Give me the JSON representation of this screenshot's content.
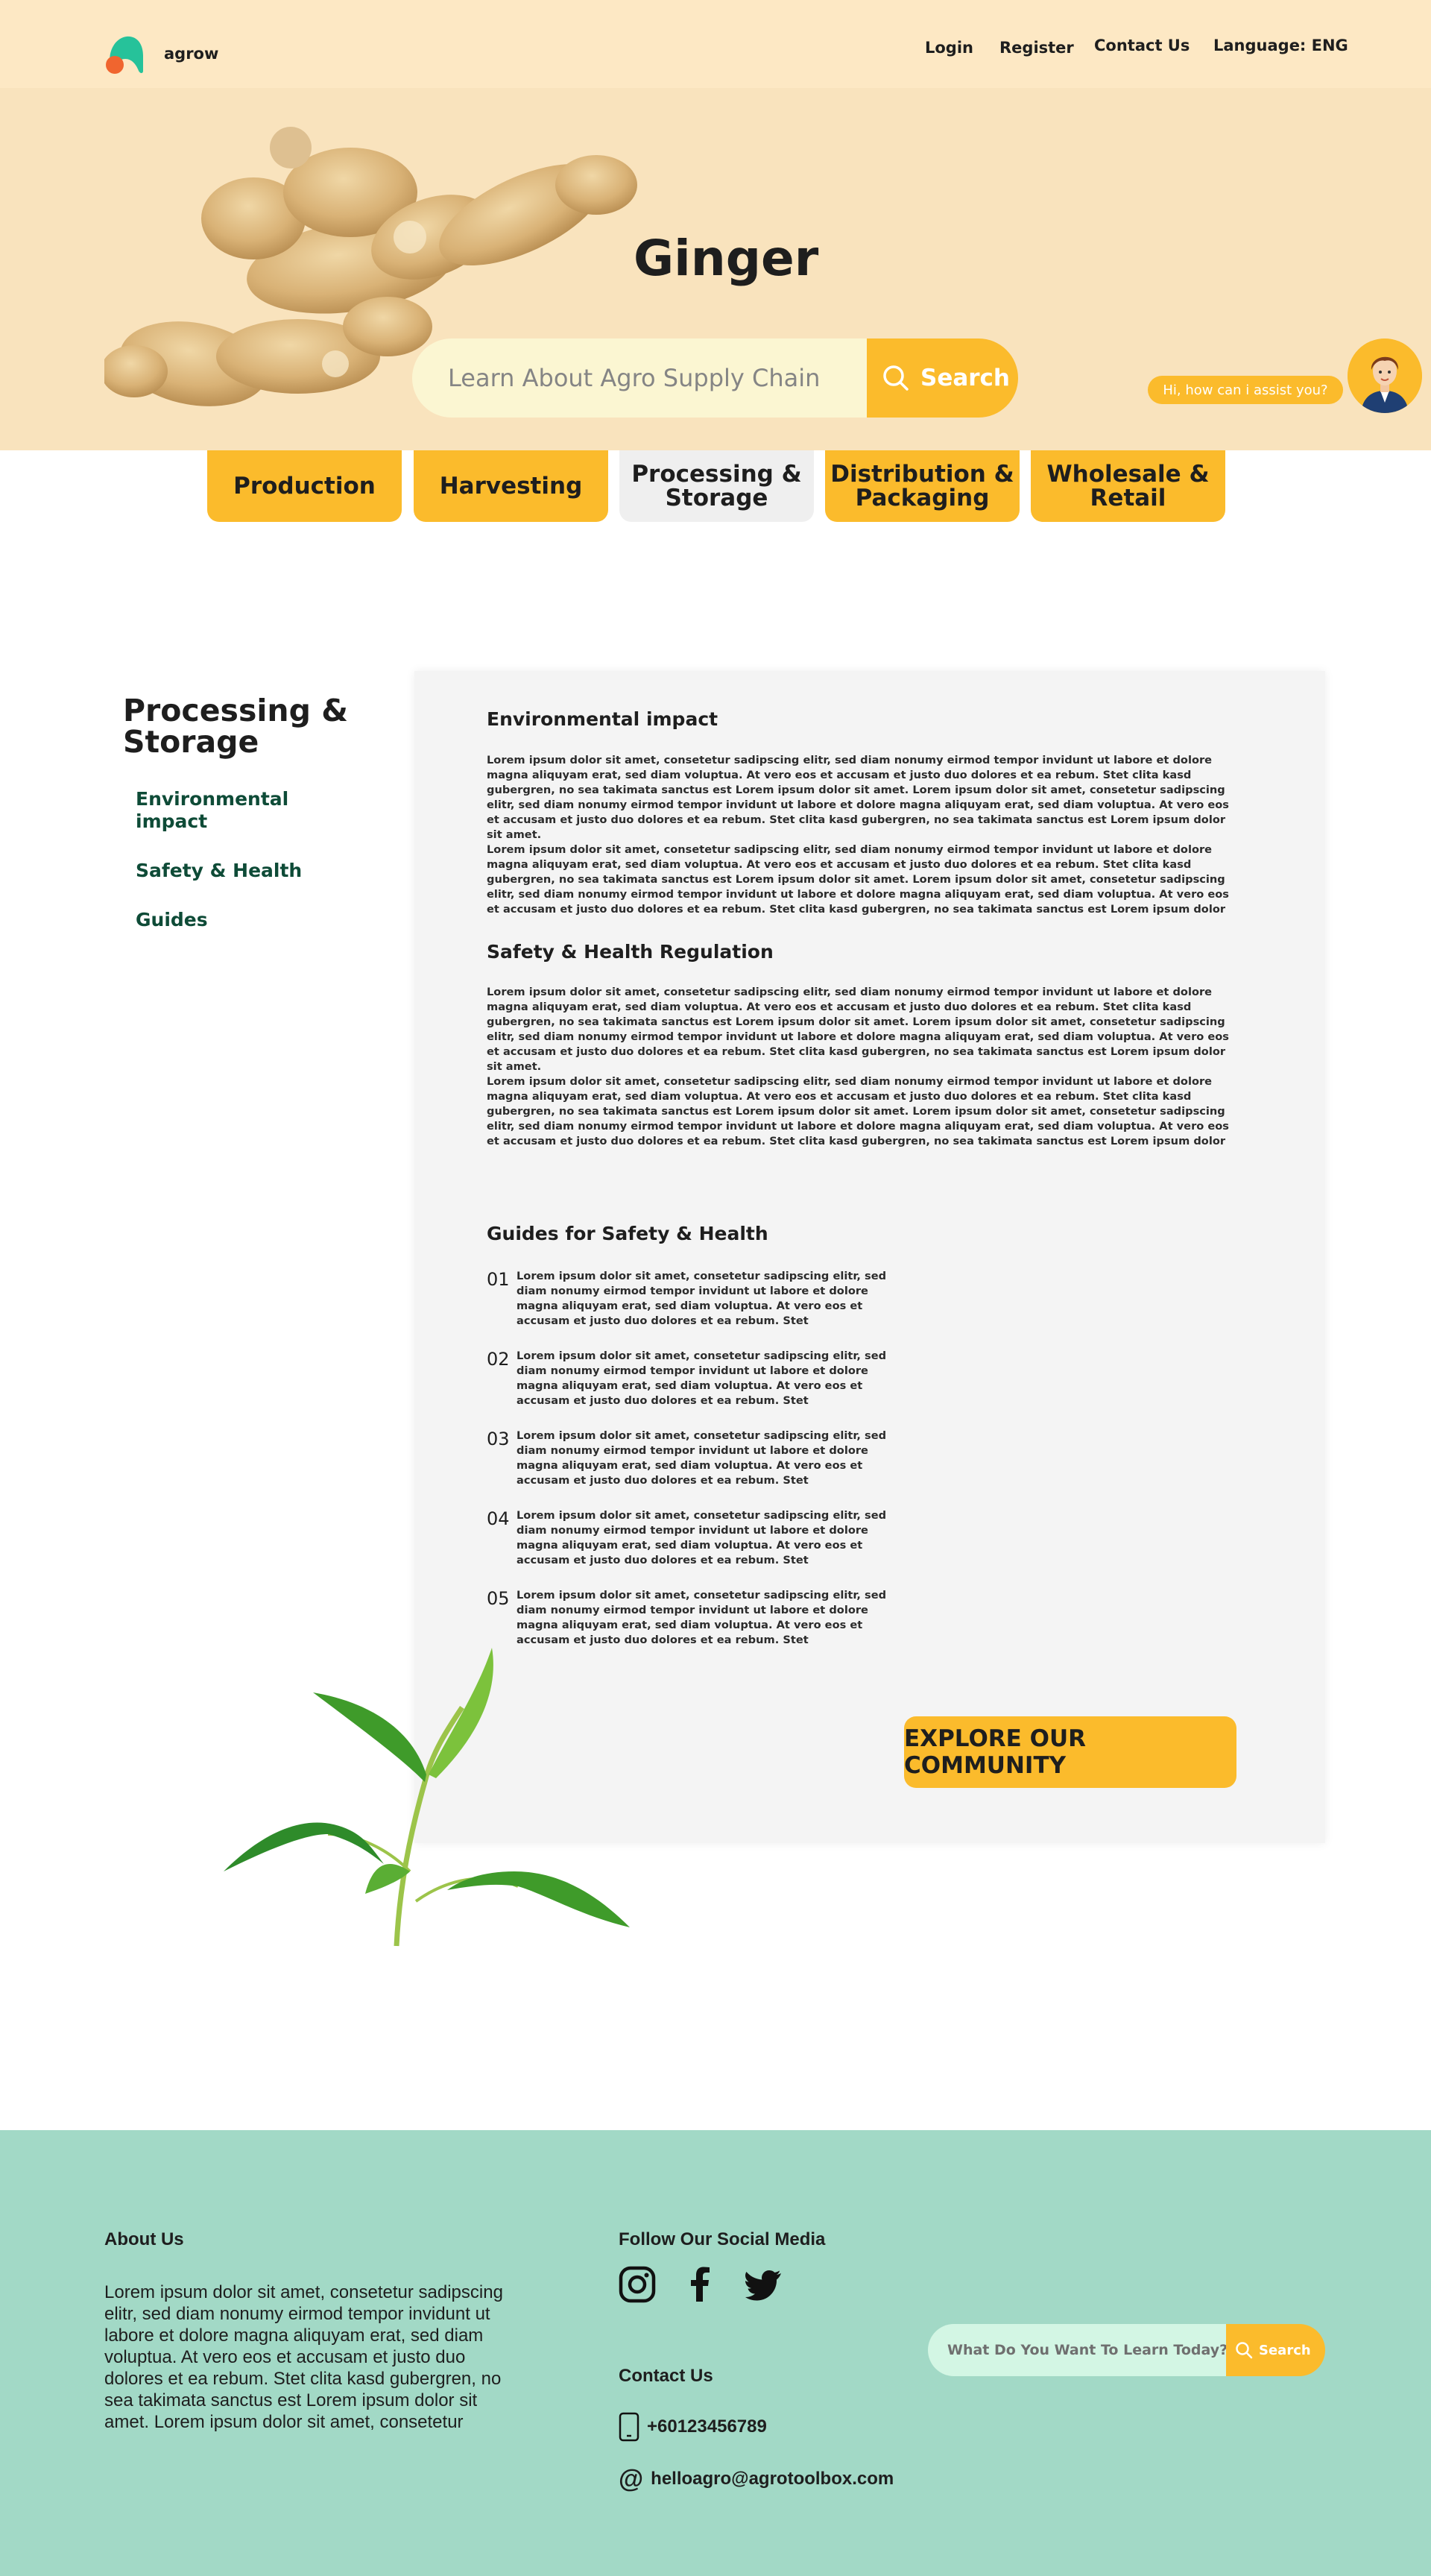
{
  "header": {
    "brand": "agrow",
    "nav": {
      "login": "Login",
      "register": "Register",
      "contact": "Contact Us",
      "language": "Language: ENG"
    }
  },
  "hero": {
    "title": "Ginger",
    "search_placeholder": "Learn About Agro Supply Chain",
    "search_label": "Search",
    "assistant_prompt": "Hi, how can i assist you?"
  },
  "tabs": [
    {
      "label": "Production"
    },
    {
      "label": "Harvesting"
    },
    {
      "label": "Processing & Storage"
    },
    {
      "label": "Distribution & Packaging"
    },
    {
      "label": "Wholesale & Retail"
    }
  ],
  "active_tab": "Processing & Storage",
  "sidebar": {
    "title": "Processing & Storage",
    "links": [
      "Environmental impact",
      "Safety & Health",
      "Guides"
    ]
  },
  "content": {
    "sections": [
      {
        "title": "Environmental impact",
        "paragraphs": [
          "Lorem ipsum dolor sit amet, consetetur sadipscing elitr, sed diam nonumy eirmod tempor invidunt ut labore et dolore magna aliquyam erat, sed diam voluptua. At vero eos et accusam et justo duo dolores et ea rebum. Stet clita kasd gubergren, no sea takimata sanctus est Lorem ipsum dolor sit amet. Lorem ipsum dolor sit amet, consetetur sadipscing elitr, sed diam nonumy eirmod tempor invidunt ut labore et dolore magna aliquyam erat, sed diam voluptua. At vero eos et accusam et justo duo dolores et ea rebum. Stet clita kasd gubergren, no sea takimata sanctus est Lorem ipsum dolor sit amet.",
          "Lorem ipsum dolor sit amet, consetetur sadipscing elitr, sed diam nonumy eirmod tempor invidunt ut labore et dolore magna aliquyam erat, sed diam voluptua. At vero eos et accusam et justo duo dolores et ea rebum. Stet clita kasd gubergren, no sea takimata sanctus est Lorem ipsum dolor sit amet. Lorem ipsum dolor sit amet, consetetur sadipscing elitr, sed diam nonumy eirmod tempor invidunt ut labore et dolore magna aliquyam erat, sed diam voluptua. At vero eos et accusam et justo duo dolores et ea rebum. Stet clita kasd gubergren, no sea takimata sanctus est Lorem ipsum dolor"
        ]
      },
      {
        "title": "Safety & Health Regulation",
        "paragraphs": [
          "Lorem ipsum dolor sit amet, consetetur sadipscing elitr, sed diam nonumy eirmod tempor invidunt ut labore et dolore magna aliquyam erat, sed diam voluptua. At vero eos et accusam et justo duo dolores et ea rebum. Stet clita kasd gubergren, no sea takimata sanctus est Lorem ipsum dolor sit amet. Lorem ipsum dolor sit amet, consetetur sadipscing elitr, sed diam nonumy eirmod tempor invidunt ut labore et dolore magna aliquyam erat, sed diam voluptua. At vero eos et accusam et justo duo dolores et ea rebum. Stet clita kasd gubergren, no sea takimata sanctus est Lorem ipsum dolor sit amet.",
          "Lorem ipsum dolor sit amet, consetetur sadipscing elitr, sed diam nonumy eirmod tempor invidunt ut labore et dolore magna aliquyam erat, sed diam voluptua. At vero eos et accusam et justo duo dolores et ea rebum. Stet clita kasd gubergren, no sea takimata sanctus est Lorem ipsum dolor sit amet. Lorem ipsum dolor sit amet, consetetur sadipscing elitr, sed diam nonumy eirmod tempor invidunt ut labore et dolore magna aliquyam erat, sed diam voluptua. At vero eos et accusam et justo duo dolores et ea rebum. Stet clita kasd gubergren, no sea takimata sanctus est Lorem ipsum dolor"
        ]
      }
    ],
    "guides_title": "Guides for Safety & Health",
    "guides": [
      {
        "num": "01",
        "text": "Lorem ipsum dolor sit amet, consetetur sadipscing elitr, sed diam nonumy eirmod tempor invidunt ut labore et dolore magna aliquyam erat, sed diam voluptua. At vero eos et accusam et justo duo dolores et ea rebum. Stet"
      },
      {
        "num": "02",
        "text": "Lorem ipsum dolor sit amet, consetetur sadipscing elitr, sed diam nonumy eirmod tempor invidunt ut labore et dolore magna aliquyam erat, sed diam voluptua. At vero eos et accusam et justo duo dolores et ea rebum. Stet"
      },
      {
        "num": "03",
        "text": "Lorem ipsum dolor sit amet, consetetur sadipscing elitr, sed diam nonumy eirmod tempor invidunt ut labore et dolore magna aliquyam erat, sed diam voluptua. At vero eos et accusam et justo duo dolores et ea rebum. Stet"
      },
      {
        "num": "04",
        "text": "Lorem ipsum dolor sit amet, consetetur sadipscing elitr, sed diam nonumy eirmod tempor invidunt ut labore et dolore magna aliquyam erat, sed diam voluptua. At vero eos et accusam et justo duo dolores et ea rebum. Stet"
      },
      {
        "num": "05",
        "text": "Lorem ipsum dolor sit amet, consetetur sadipscing elitr, sed diam nonumy eirmod tempor invidunt ut labore et dolore magna aliquyam erat, sed diam voluptua. At vero eos et accusam et justo duo dolores et ea rebum. Stet"
      }
    ],
    "cta_label": "EXPLORE OUR COMMUNITY"
  },
  "footer": {
    "about_title": "About Us",
    "about_text": "Lorem ipsum dolor sit amet, consetetur sadipscing elitr, sed diam nonumy eirmod tempor invidunt ut labore et dolore magna aliquyam erat, sed diam voluptua. At vero eos et accusam et justo duo dolores et ea rebum. Stet clita kasd gubergren, no sea takimata sanctus est Lorem ipsum dolor sit amet. Lorem ipsum dolor sit amet, consetetur",
    "social_title": "Follow Our Social Media",
    "social_icons": [
      "instagram-icon",
      "facebook-icon",
      "twitter-icon"
    ],
    "contact_title": "Contact Us",
    "phone": "+60123456789",
    "email": "helloagro@agrotoolbox.com",
    "search_placeholder": "What Do You Want To Learn Today?",
    "search_label": "Search"
  },
  "colors": {
    "topbar": "#fde8c4",
    "hero": "#f9e3bd",
    "accent": "#fbbb2c",
    "active_tab": "#efefef",
    "sidebar_link": "#0e4b37",
    "card": "#f4f4f4",
    "footer": "#a2d9c6"
  }
}
